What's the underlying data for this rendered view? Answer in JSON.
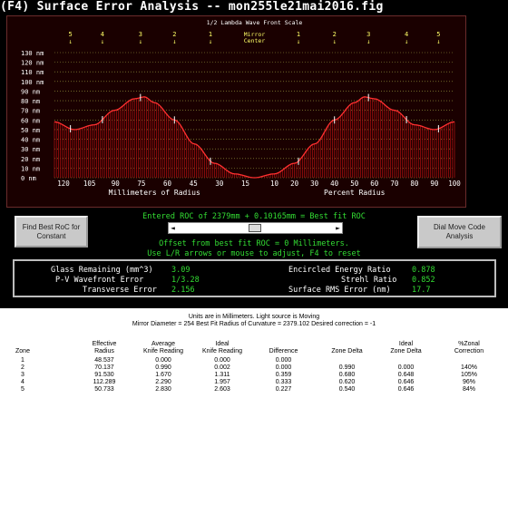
{
  "window": {
    "title": "(F4) Surface Error Analysis -- mon255le21mai2016.fig"
  },
  "wavefront_chart": {
    "caption": "1/2 Lambda Wave Front Scale",
    "mirror_label": "Mirror",
    "center_label": "Center",
    "y_unit": "nm",
    "y_ticks": [
      130,
      120,
      110,
      100,
      90,
      80,
      70,
      60,
      50,
      40,
      30,
      20,
      10,
      0
    ],
    "x_left_ticks": [
      "120",
      "105",
      "90",
      "75",
      "60",
      "45",
      "30",
      "15"
    ],
    "x_right_ticks": [
      "10",
      "20",
      "30",
      "40",
      "50",
      "60",
      "70",
      "80",
      "90",
      "100"
    ],
    "x_left_label": "Millimeters of Radius",
    "x_right_label": "Percent Radius",
    "zone_markers_left": [
      "5",
      "4",
      "3",
      "2",
      "1"
    ],
    "zone_markers_right": [
      "1",
      "2",
      "3",
      "4",
      "5"
    ],
    "left_zone_arrows": [
      "↓",
      "↓",
      "↓",
      "↓",
      "↓"
    ],
    "right_zone_arrows": [
      "↓",
      "↓",
      "↓",
      "↓",
      "↓"
    ],
    "colors": {
      "curve": "#ff3030",
      "fill": "#b01010",
      "grid": "#a0a040",
      "axis_text": "#ffffff",
      "markers": "#ffff66"
    }
  },
  "chart_data": {
    "type": "area",
    "title": "1/2 Lambda Wave Front Scale",
    "xlabel_left": "Millimeters of Radius",
    "xlabel_right": "Percent Radius",
    "ylabel": "nm",
    "ylim": [
      0,
      130
    ],
    "x_percent_radius": [
      0,
      10,
      20,
      30,
      40,
      50,
      55,
      60,
      70,
      80,
      90,
      100
    ],
    "wavefront_nm": [
      0,
      4,
      15,
      35,
      60,
      78,
      84,
      82,
      70,
      55,
      50,
      58
    ],
    "grid": true
  },
  "buttons": {
    "find_best": "Find Best RoC for Constant",
    "dial_move": "Dial Move Code Analysis"
  },
  "roc": {
    "line": "Entered ROC of 2379mm + 0.10165mm = Best fit ROC",
    "offset": "Offset from best fit ROC = 0 Millimeters.",
    "adjust": "Use L/R arrows or mouse to adjust, F4 to reset"
  },
  "slider": {
    "left_arrow": "◄",
    "right_arrow": "►"
  },
  "results": {
    "glass_removed_label": "Glass Remaining (mm^3)",
    "glass_removed_value": "3.09",
    "pv_label": "P-V Wavefront Error",
    "pv_value": "1/3.28",
    "transverse_label": "Transverse Error",
    "transverse_value": "2.156",
    "encircled_label": "Encircled Energy Ratio",
    "encircled_value": "0.878",
    "strehl_label": "Strehl Ratio",
    "strehl_value": "0.852",
    "rms_label": "Surface RMS Error (nm)",
    "rms_value": "17.7"
  },
  "table": {
    "line1": "Units are in Millimeters. Light source is Moving",
    "line2": "Mirror Diameter = 254    Best Fit Radius of Curvature = 2379.102    Desired correction = -1",
    "headers_top": [
      "",
      "Effective",
      "Average",
      "Ideal",
      "",
      "",
      "Ideal",
      "%Zonal"
    ],
    "headers_bottom": [
      "Zone",
      "Radius",
      "Knife Reading",
      "Knife Reading",
      "Difference",
      "Zone Delta",
      "Zone Delta",
      "Correction"
    ],
    "rows": [
      [
        "1",
        "48.537",
        "0.000",
        "0.000",
        "0.000",
        "",
        "",
        ""
      ],
      [
        "2",
        "70.137",
        "0.990",
        "0.002",
        "0.000",
        "0.990",
        "0.000",
        "140%"
      ],
      [
        "3",
        "91.530",
        "1.670",
        "1.311",
        "0.359",
        "0.680",
        "0.648",
        "105%"
      ],
      [
        "4",
        "112.289",
        "2.290",
        "1.957",
        "0.333",
        "0.620",
        "0.646",
        "96%"
      ],
      [
        "5",
        "50.733",
        "2.830",
        "2.603",
        "0.227",
        "0.540",
        "0.646",
        "84%"
      ]
    ]
  }
}
